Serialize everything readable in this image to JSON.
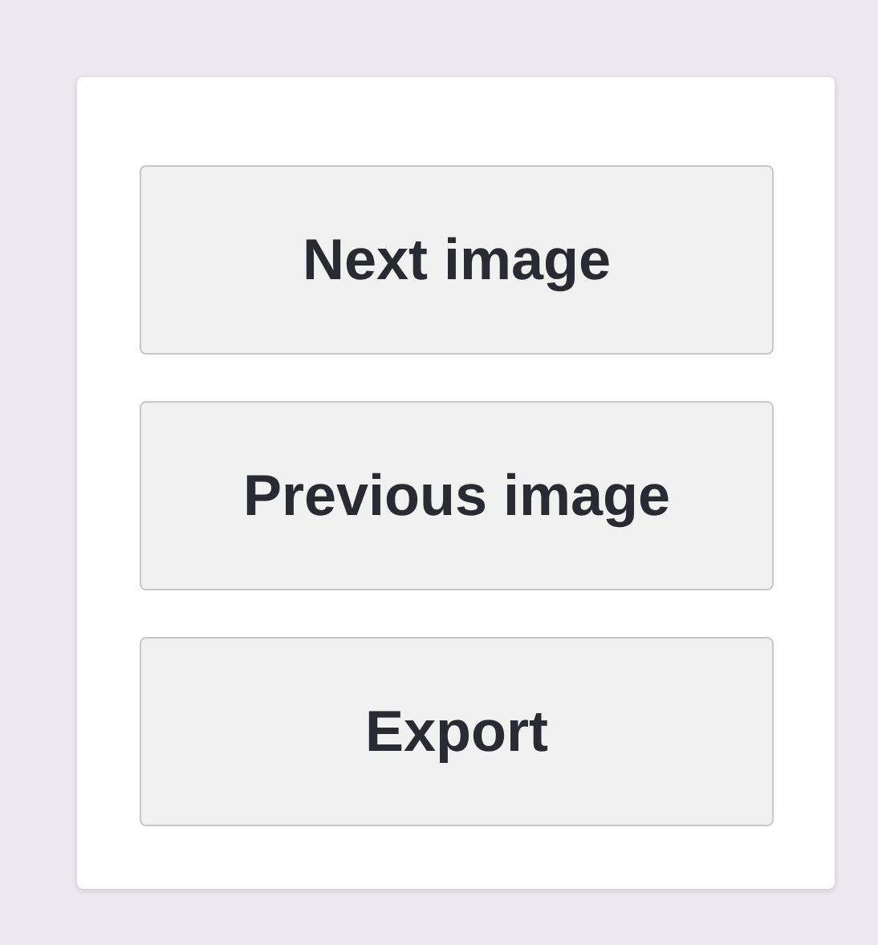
{
  "buttons": [
    {
      "label": "Next image"
    },
    {
      "label": "Previous image"
    },
    {
      "label": "Export"
    }
  ]
}
